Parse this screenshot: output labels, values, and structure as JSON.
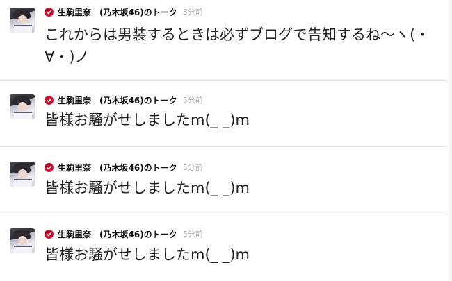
{
  "posts": [
    {
      "author": "生駒里奈",
      "suffix": "(乃木坂46)のトーク",
      "time": "3分前",
      "text": "これからは男装するときは必ずブログで告知するね〜ヽ(・∀・)ノ",
      "icons": {
        "avatar": "user-avatar",
        "verified": "verified-check-icon"
      }
    },
    {
      "author": "生駒里奈",
      "suffix": "(乃木坂46)のトーク",
      "time": "5分前",
      "text": "皆様お騒がせしましたm(_ _)m",
      "icons": {
        "avatar": "user-avatar",
        "verified": "verified-check-icon"
      }
    },
    {
      "author": "生駒里奈",
      "suffix": "(乃木坂46)のトーク",
      "time": "5分前",
      "text": "皆様お騒がせしましたm(_ _)m",
      "icons": {
        "avatar": "user-avatar",
        "verified": "verified-check-icon"
      }
    },
    {
      "author": "生駒里奈",
      "suffix": "(乃木坂46)のトーク",
      "time": "5分前",
      "text": "皆様お騒がせしましたm(_ _)m",
      "icons": {
        "avatar": "user-avatar",
        "verified": "verified-check-icon"
      }
    }
  ],
  "colors": {
    "verified": "#c8102e",
    "timestamp": "#b0b0b0",
    "divider": "#e4e4e4"
  }
}
